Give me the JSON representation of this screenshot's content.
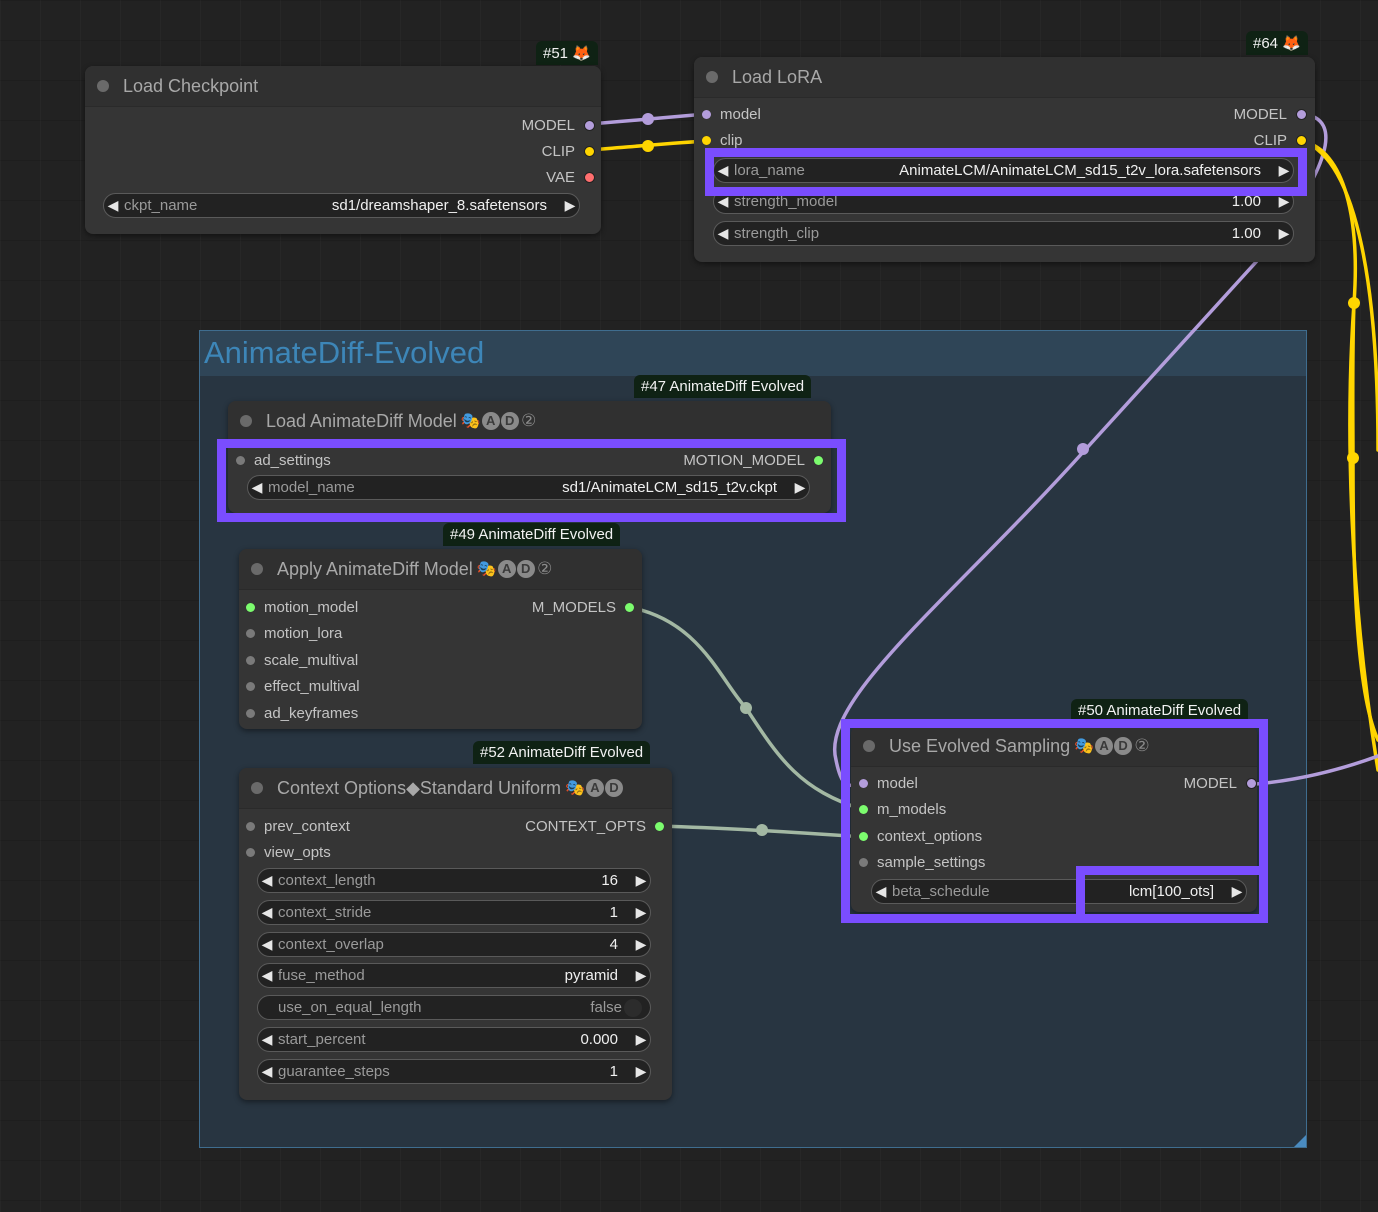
{
  "colors": {
    "model_wire": "#b39ddb",
    "clip_wire": "#ffd500",
    "motion_wire": "#a3b8a3",
    "model_pin": "#b39ddb",
    "clip_pin": "#ffd500",
    "vae_pin": "#ff6e6e",
    "green_pin": "#7cfc6e",
    "empty_pin": "#7a7a7a",
    "highlight": "#7a4dff"
  },
  "group": {
    "title": "AnimateDiff-Evolved"
  },
  "nodes": {
    "load_checkpoint": {
      "tag": "#51 🦊",
      "title": "Load Checkpoint",
      "outputs": [
        "MODEL",
        "CLIP",
        "VAE"
      ],
      "widgets": [
        {
          "label": "ckpt_name",
          "value": "sd1/dreamshaper_8.safetensors"
        }
      ]
    },
    "load_lora": {
      "tag": "#64 🦊",
      "title": "Load LoRA",
      "inputs": [
        "model",
        "clip"
      ],
      "outputs": [
        "MODEL",
        "CLIP"
      ],
      "widgets": [
        {
          "label": "lora_name",
          "value": "AnimateLCM/AnimateLCM_sd15_t2v_lora.safetensors"
        },
        {
          "label": "strength_model",
          "value": "1.00"
        },
        {
          "label": "strength_clip",
          "value": "1.00"
        }
      ]
    },
    "load_ad_model": {
      "tag": "#47 AnimateDiff Evolved",
      "title": "Load AnimateDiff Model",
      "emoji": "🎭",
      "badge": [
        "A",
        "D",
        "2"
      ],
      "inputs": [
        "ad_settings"
      ],
      "outputs": [
        "MOTION_MODEL"
      ],
      "widgets": [
        {
          "label": "model_name",
          "value": "sd1/AnimateLCM_sd15_t2v.ckpt"
        }
      ]
    },
    "apply_ad_model": {
      "tag": "#49 AnimateDiff Evolved",
      "title": "Apply AnimateDiff Model",
      "emoji": "🎭",
      "badge": [
        "A",
        "D",
        "2"
      ],
      "inputs": [
        "motion_model",
        "motion_lora",
        "scale_multival",
        "effect_multival",
        "ad_keyframes"
      ],
      "outputs": [
        "M_MODELS"
      ]
    },
    "context_options": {
      "tag": "#52 AnimateDiff Evolved",
      "title": "Context Options◆Standard Uniform",
      "emoji": "🎭",
      "badge": [
        "A",
        "D"
      ],
      "inputs": [
        "prev_context",
        "view_opts"
      ],
      "outputs": [
        "CONTEXT_OPTS"
      ],
      "widgets": [
        {
          "label": "context_length",
          "value": "16"
        },
        {
          "label": "context_stride",
          "value": "1"
        },
        {
          "label": "context_overlap",
          "value": "4"
        },
        {
          "label": "fuse_method",
          "value": "pyramid"
        },
        {
          "label": "use_on_equal_length",
          "value": "false"
        },
        {
          "label": "start_percent",
          "value": "0.000"
        },
        {
          "label": "guarantee_steps",
          "value": "1"
        }
      ]
    },
    "use_evolved_sampling": {
      "tag": "#50 AnimateDiff Evolved",
      "title": "Use Evolved Sampling",
      "emoji": "🎭",
      "badge": [
        "A",
        "D",
        "2"
      ],
      "inputs": [
        "model",
        "m_models",
        "context_options",
        "sample_settings"
      ],
      "outputs": [
        "MODEL"
      ],
      "widgets": [
        {
          "label": "beta_schedule",
          "value": "lcm[100_ots]"
        }
      ]
    }
  },
  "icons": {
    "arrow_left": "◀",
    "arrow_right": "▶"
  }
}
